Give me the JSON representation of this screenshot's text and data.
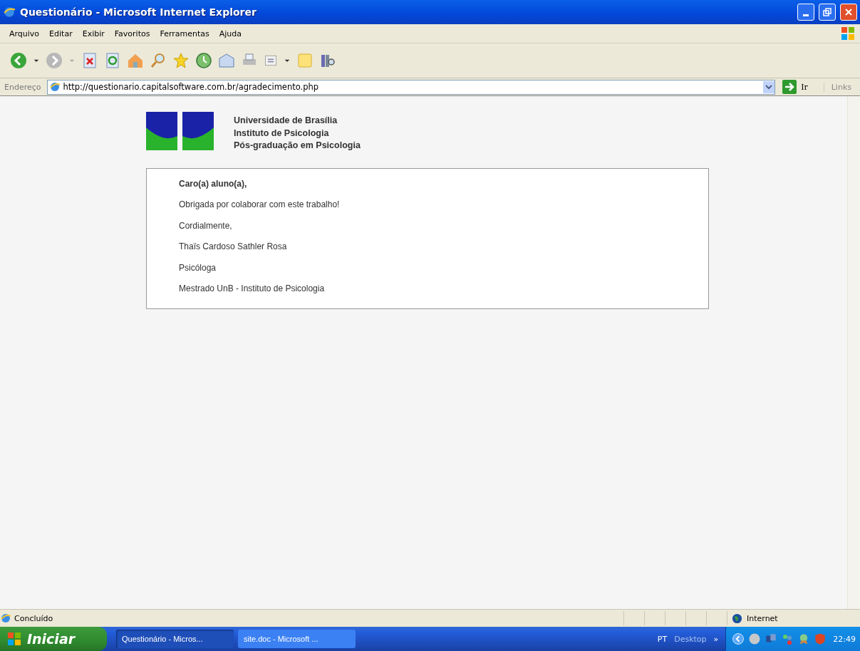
{
  "window": {
    "title": "Questionário - Microsoft Internet Explorer"
  },
  "menu": [
    "Arquivo",
    "Editar",
    "Exibir",
    "Favoritos",
    "Ferramentas",
    "Ajuda"
  ],
  "address": {
    "label": "Endereço",
    "value": "http://questionario.capitalsoftware.com.br/agradecimento.php",
    "go": "Ir",
    "links": "Links"
  },
  "header": {
    "lines": [
      "Universidade de Brasília",
      "Instituto de Psicologia",
      "Pós-graduação em Psicologia"
    ]
  },
  "message": {
    "greeting": "Caro(a) aluno(a),",
    "lines": [
      "Obrigada por colaborar com este trabalho!",
      "Cordialmente,",
      "Thaïs Cardoso Sathler Rosa",
      "Psicóloga",
      "Mestrado UnB - Instituto de Psicologia"
    ]
  },
  "status_bar": {
    "text": "Concluído",
    "zone": "Internet"
  },
  "taskbar": {
    "start": "Iniciar",
    "tasks": [
      {
        "label": "Questionário - Micros...",
        "selected": true
      },
      {
        "label": "site.doc - Microsoft ...",
        "selected": false
      }
    ],
    "language": "PT",
    "toolbar": "Desktop",
    "chevron": "»",
    "clock": "22:49"
  }
}
